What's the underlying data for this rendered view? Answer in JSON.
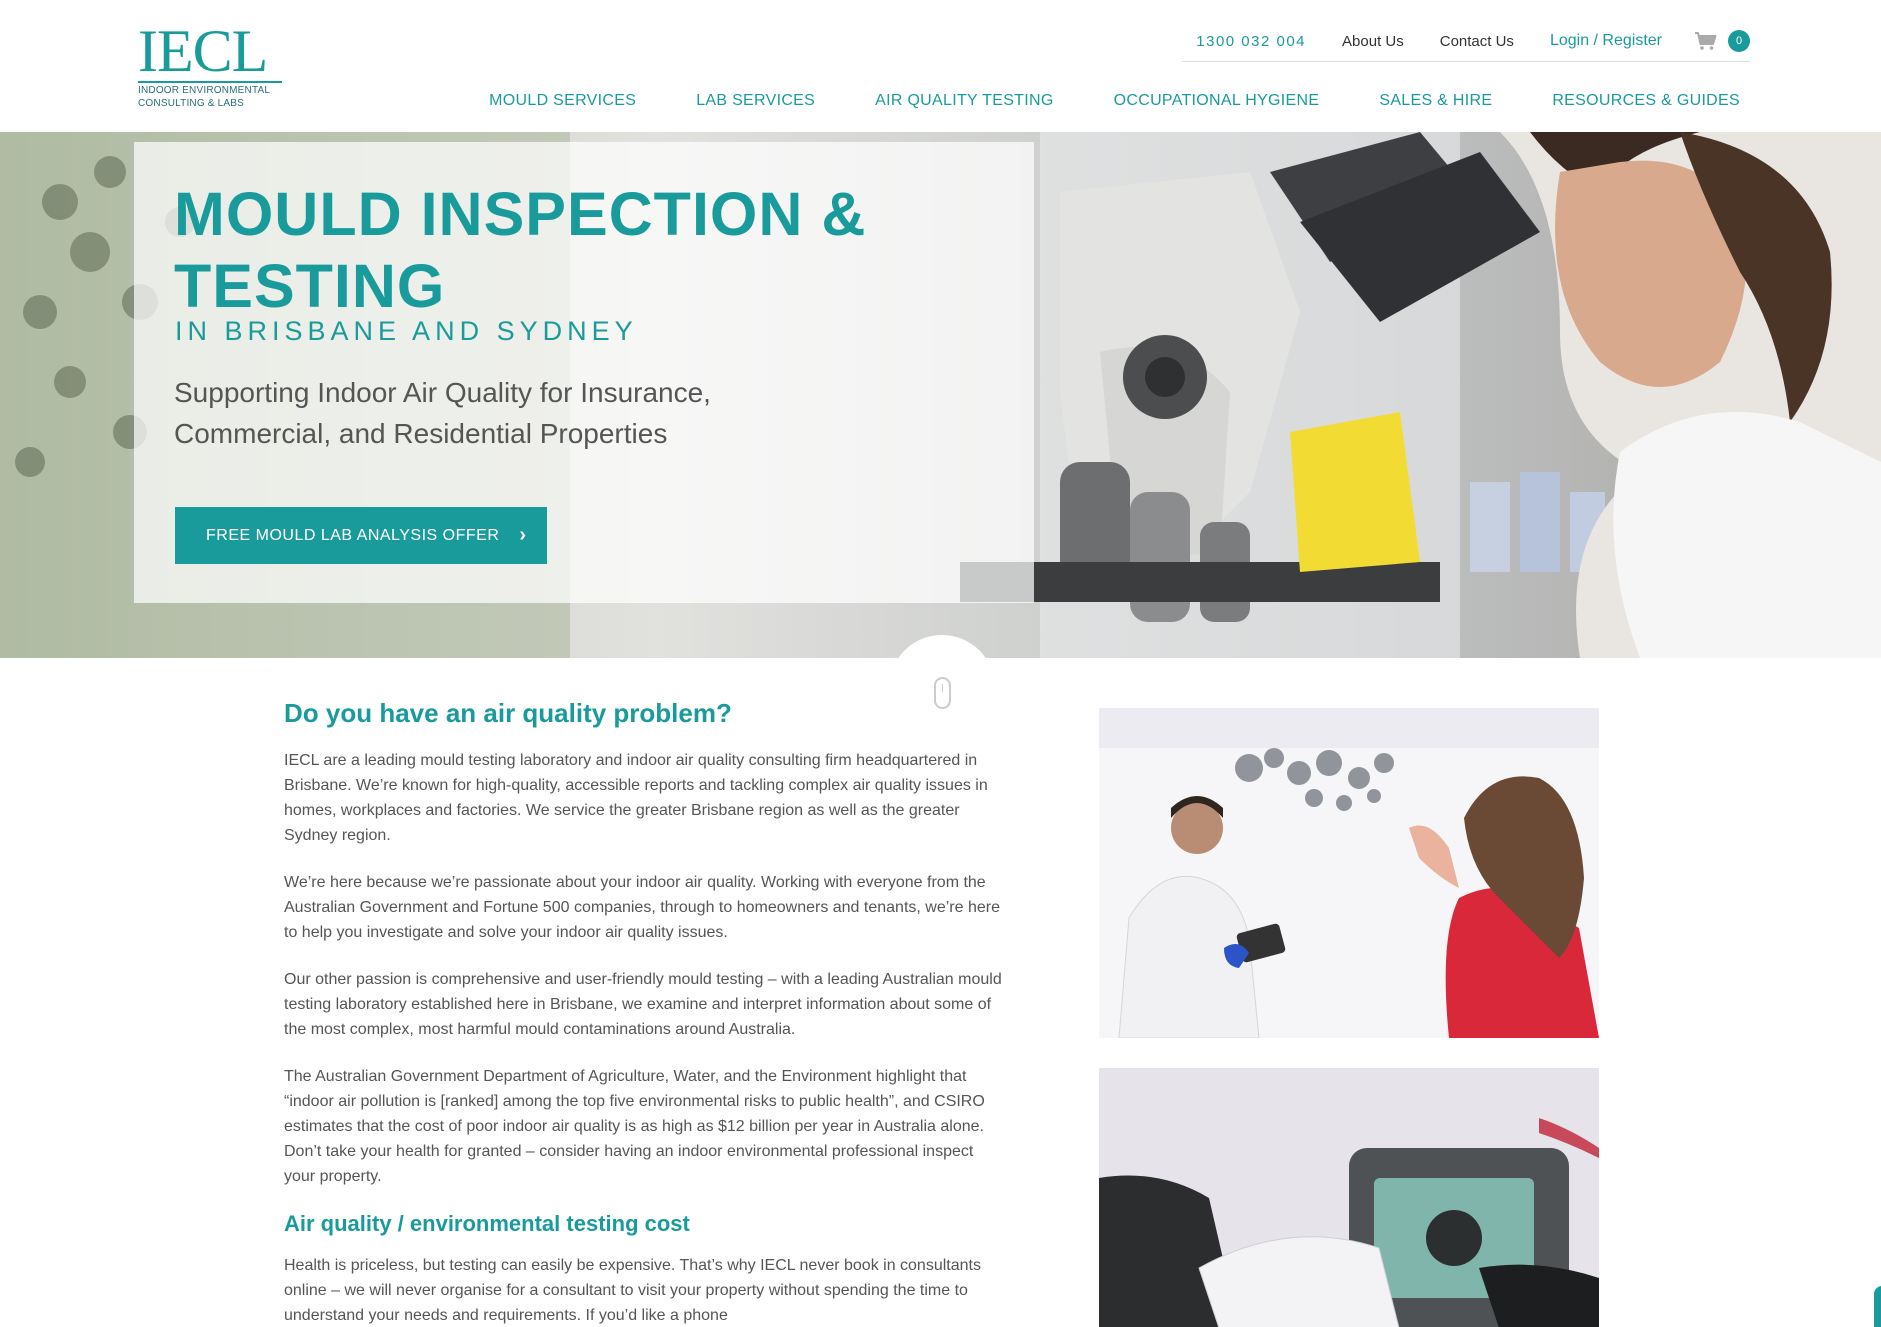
{
  "brand": {
    "logo_text": "IECL",
    "logo_subtitle_line1": "INDOOR ENVIRONMENTAL",
    "logo_subtitle_line2": "CONSULTING & LABS",
    "accent_color": "#1a9b9b"
  },
  "topbar": {
    "phone": "1300 032 004",
    "about": "About Us",
    "contact": "Contact Us",
    "login": "Login / Register",
    "cart_icon": "shopping-cart-icon",
    "cart_count": "0"
  },
  "nav": {
    "items": [
      "MOULD SERVICES",
      "LAB SERVICES",
      "AIR QUALITY TESTING",
      "OCCUPATIONAL HYGIENE",
      "SALES & HIRE",
      "RESOURCES & GUIDES"
    ]
  },
  "hero": {
    "title": "MOULD INSPECTION & TESTING",
    "subtitle": "IN BRISBANE AND SYDNEY",
    "description": "Supporting Indoor Air Quality for Insurance, Commercial, and Residential Properties",
    "cta": "FREE MOULD LAB ANALYSIS OFFER",
    "cta_icon": "chevron-right-icon"
  },
  "main": {
    "heading1": "Do you have an air quality problem?",
    "paragraphs": [
      "IECL are a leading mould testing laboratory and indoor air quality consulting firm headquartered in Brisbane. We’re known for high-quality, accessible reports and tackling complex air quality issues in homes, workplaces and factories. We service the greater Brisbane region as well as the greater Sydney region.",
      "We’re here because we’re passionate about your indoor air quality. Working with everyone from the Australian Government and Fortune 500 companies, through to homeowners and tenants, we’re here to help you investigate and solve your indoor air quality issues.",
      "Our other passion is comprehensive and user-friendly mould testing – with a leading Australian mould testing laboratory established here in Brisbane, we examine and interpret information about some of the most complex, most harmful mould contaminations around Australia.",
      "The Australian Government Department of Agriculture, Water, and the Environment highlight that “indoor air pollution is [ranked] among the top five environmental risks to public health”, and CSIRO estimates that the cost of poor indoor air quality is as high as $12 billion per year in Australia alone. Don’t take your health for granted – consider having an indoor environmental professional inspect your property."
    ],
    "heading2": "Air quality / environmental testing cost",
    "paragraph5": "Health is priceless, but testing can easily be expensive. That’s why IECL never book in consultants online – we will never organise for a consultant to visit your property without spending the time to understand your needs and requirements. If you’d like a phone"
  }
}
